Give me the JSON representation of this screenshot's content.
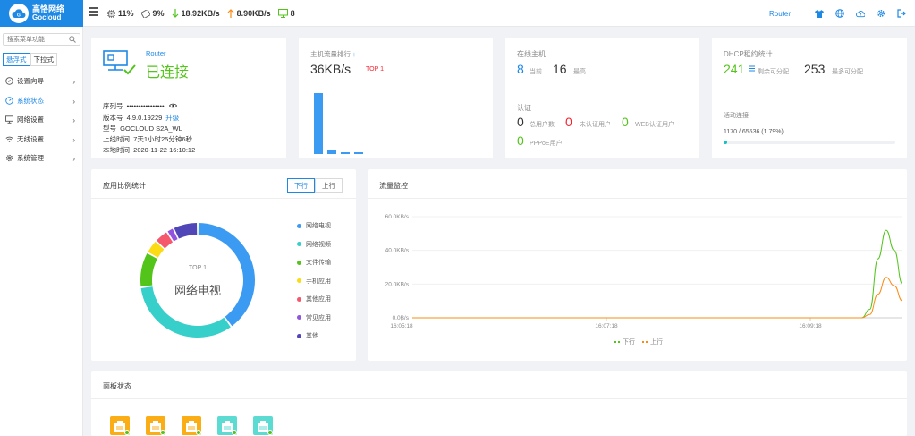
{
  "header": {
    "logo_cn": "高恪网络",
    "logo_en": "Gocloud",
    "cpu": "11%",
    "mem": "9%",
    "down_speed": "18.92KB/s",
    "up_speed": "8.90KB/s",
    "hosts": "8",
    "router_link": "Router"
  },
  "sidebar": {
    "search_placeholder": "搜索菜单功能",
    "mode_tabs": [
      "悬浮式",
      "下拉式"
    ],
    "items": [
      {
        "label": "设置向导",
        "icon": "compass-icon"
      },
      {
        "label": "系统状态",
        "icon": "dashboard-icon"
      },
      {
        "label": "网络设置",
        "icon": "monitor-icon"
      },
      {
        "label": "无线设置",
        "icon": "wifi-icon"
      },
      {
        "label": "系统管理",
        "icon": "gear-icon"
      }
    ]
  },
  "router_card": {
    "label": "Router",
    "status": "已连接",
    "serial_label": "序列号",
    "serial_value": "••••••••••••••••",
    "version_label": "版本号",
    "version_value": "4.9.0.19229",
    "upgrade": "升级",
    "model_label": "型号",
    "model_value": "GOCLOUD S2A_WL",
    "uptime_label": "上线时间",
    "uptime_value": "7天1小时25分钟6秒",
    "localtime_label": "本地时间",
    "localtime_value": "2020-11-22 16:10:12"
  },
  "flow_card": {
    "title": "主机流量排行",
    "value": "36KB/s",
    "top": "TOP 1",
    "bars": [
      1.0,
      0.06,
      0.02,
      0.02
    ]
  },
  "hosts_card": {
    "title": "在线主机",
    "current_value": "8",
    "current_label": "当前",
    "max_value": "16",
    "max_label": "最高",
    "auth_title": "认证",
    "total_value": "0",
    "total_label": "总用户数",
    "unauth_value": "0",
    "unauth_label": "未认证用户",
    "web_value": "0",
    "web_label": "WEB认证用户",
    "pppoe_value": "0",
    "pppoe_label": "PPPoE用户"
  },
  "dhcp_card": {
    "title": "DHCP租约统计",
    "remaining_value": "241",
    "remaining_label": "剩余可分配",
    "max_value": "253",
    "max_label": "最多可分配",
    "conn_title": "活动连接",
    "conn_text": "1170 / 65536 (1.79%)",
    "conn_fraction": 0.0179
  },
  "app_card": {
    "title": "应用比例统计",
    "tabs": [
      "下行",
      "上行"
    ],
    "center_top": "TOP 1",
    "center_label": "网络电视",
    "legend": [
      {
        "label": "网络电视",
        "color": "#3b9bf2"
      },
      {
        "label": "网络视频",
        "color": "#36cfc9"
      },
      {
        "label": "文件传输",
        "color": "#52c41a"
      },
      {
        "label": "手机应用",
        "color": "#fadb14"
      },
      {
        "label": "其他应用",
        "color": "#f5576c"
      },
      {
        "label": "常见应用",
        "color": "#9254de"
      },
      {
        "label": "其他",
        "color": "#5046b8"
      }
    ],
    "slices": [
      0.4,
      0.33,
      0.1,
      0.04,
      0.04,
      0.02,
      0.07
    ]
  },
  "traffic_card": {
    "title": "流量监控",
    "y_ticks": [
      "60.0KB/s",
      "40.0KB/s",
      "20.0KB/s",
      "0.0B/s"
    ],
    "x_ticks": [
      "16:05:18",
      "16:07:18",
      "16:09:18"
    ],
    "legend_down": "下行",
    "legend_up": "上行",
    "color_down": "#52c41a",
    "color_up": "#fa8c16"
  },
  "chart_data": {
    "type": "line",
    "title": "流量监控",
    "xlabel": "",
    "ylabel": "",
    "ylim": [
      0,
      60
    ],
    "y_unit": "KB/s",
    "x_tick_labels": [
      "16:05:18",
      "16:07:18",
      "16:09:18"
    ],
    "series": [
      {
        "name": "下行",
        "color": "#52c41a",
        "values": [
          0,
          0,
          0,
          0,
          0,
          0,
          0,
          0,
          0,
          0,
          0,
          0,
          0,
          0,
          0,
          0,
          0,
          0,
          0,
          0,
          0,
          0,
          0,
          0,
          0,
          0,
          0,
          0,
          0,
          0,
          0,
          0,
          0,
          0,
          0,
          0,
          0,
          0,
          0,
          0,
          0,
          0,
          0,
          0,
          0,
          0,
          0,
          0,
          0,
          0,
          0,
          0,
          0,
          0,
          0,
          0,
          5,
          35,
          52,
          40,
          20
        ]
      },
      {
        "name": "上行",
        "color": "#fa8c16",
        "values": [
          0,
          0,
          0,
          0,
          0,
          0,
          0,
          0,
          0,
          0,
          0,
          0,
          0,
          0,
          0,
          0,
          0,
          0,
          0,
          0,
          0,
          0,
          0,
          0,
          0,
          0,
          0,
          0,
          0,
          0,
          0,
          0,
          0,
          0,
          0,
          0,
          0,
          0,
          0,
          0,
          0,
          0,
          0,
          0,
          0,
          0,
          0,
          0,
          0,
          0,
          0,
          0,
          0,
          0,
          0,
          0,
          2,
          14,
          24,
          19,
          10
        ]
      }
    ]
  },
  "panel_card": {
    "title": "面板状态",
    "ports": [
      {
        "color": "#faad14"
      },
      {
        "color": "#faad14"
      },
      {
        "color": "#faad14"
      },
      {
        "color": "#5cdbd3"
      },
      {
        "color": "#5cdbd3"
      }
    ]
  }
}
